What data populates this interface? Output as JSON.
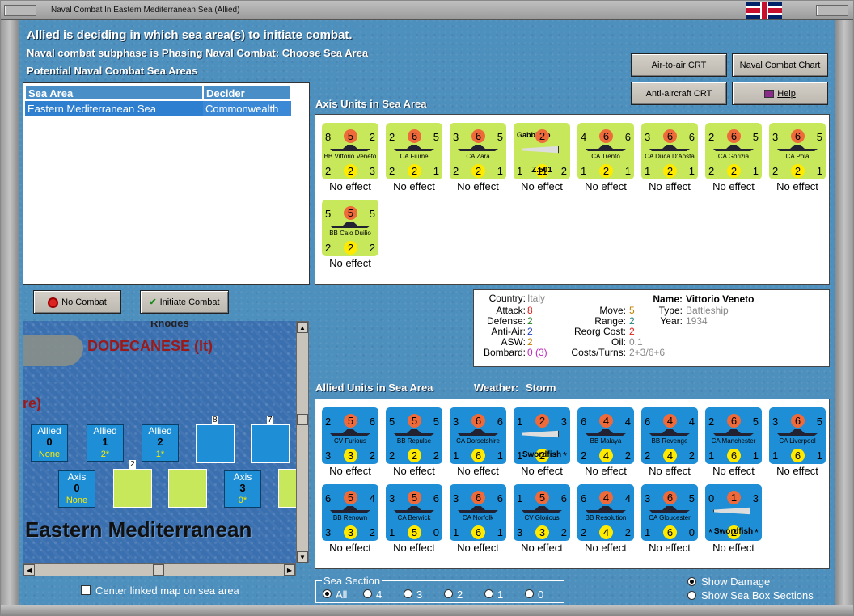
{
  "window": {
    "title": "Naval Combat In Eastern Mediterranean Sea (Allied)"
  },
  "header": {
    "status": "Allied is deciding in which sea area(s) to initiate combat.",
    "subphase": "Naval combat subphase is Phasing Naval Combat: Choose Sea Area",
    "potential": "Potential Naval Combat Sea Areas"
  },
  "buttons": {
    "air_to_air": "Air-to-air CRT",
    "naval_chart": "Naval Combat Chart",
    "anti_aircraft": "Anti-aircraft CRT",
    "help": "Help",
    "no_combat": "No Combat",
    "initiate_combat": "Initiate Combat"
  },
  "sea_table": {
    "columns": [
      "Sea Area",
      "Decider"
    ],
    "rows": [
      [
        "Eastern Mediterranean Sea",
        "Commonwealth"
      ]
    ]
  },
  "axis_title": "Axis Units in Sea Area",
  "allied_title": "Allied Units in Sea Area",
  "weather_label": "Weather:",
  "weather": "Storm",
  "effect_text": "No effect",
  "axis_units": [
    {
      "name": "BB Vittorio Veneto",
      "tl": "8",
      "tc": "5",
      "tr": "2",
      "bl": "2",
      "bc": "2",
      "br": "3"
    },
    {
      "name": "CA Fiume",
      "tl": "2",
      "tc": "6",
      "tr": "5",
      "bl": "2",
      "bc": "2",
      "br": "1"
    },
    {
      "name": "CA Zara",
      "tl": "3",
      "tc": "6",
      "tr": "5",
      "bl": "2",
      "bc": "2",
      "br": "1"
    },
    {
      "name": "Z.501",
      "tl": "Gabbiano",
      "tc": "2",
      "tr": "",
      "bl": "1",
      "bc": "11",
      "br": "2",
      "air": true
    },
    {
      "name": "CA Trento",
      "tl": "4",
      "tc": "6",
      "tr": "6",
      "bl": "1",
      "bc": "2",
      "br": "1"
    },
    {
      "name": "CA Duca D'Aosta",
      "tl": "3",
      "tc": "6",
      "tr": "6",
      "bl": "1",
      "bc": "2",
      "br": "1"
    },
    {
      "name": "CA Gorizia",
      "tl": "2",
      "tc": "6",
      "tr": "5",
      "bl": "2",
      "bc": "2",
      "br": "1"
    },
    {
      "name": "CA Pola",
      "tl": "3",
      "tc": "6",
      "tr": "5",
      "bl": "2",
      "bc": "2",
      "br": "1"
    },
    {
      "name": "BB Caio Duilio",
      "tl": "5",
      "tc": "5",
      "tr": "5",
      "bl": "2",
      "bc": "2",
      "br": "2"
    }
  ],
  "allied_units": [
    {
      "name": "CV Furious",
      "tl": "2",
      "tc": "5",
      "tr": "6",
      "bl": "3",
      "bc": "3",
      "br": "2"
    },
    {
      "name": "BB Repulse",
      "tl": "5",
      "tc": "5",
      "tr": "5",
      "bl": "2",
      "bc": "2",
      "br": "2"
    },
    {
      "name": "CA Dorsetshire",
      "tl": "3",
      "tc": "6",
      "tr": "6",
      "bl": "1",
      "bc": "6",
      "br": "1"
    },
    {
      "name": "Swordfish",
      "tl": "1",
      "tc": "2",
      "tr": "3",
      "bl": "1",
      "bc": "2",
      "br": "*",
      "air": true
    },
    {
      "name": "BB Malaya",
      "tl": "6",
      "tc": "4",
      "tr": "4",
      "bl": "2",
      "bc": "4",
      "br": "2"
    },
    {
      "name": "BB Revenge",
      "tl": "6",
      "tc": "4",
      "tr": "4",
      "bl": "2",
      "bc": "4",
      "br": "2"
    },
    {
      "name": "CA Manchester",
      "tl": "2",
      "tc": "6",
      "tr": "5",
      "bl": "1",
      "bc": "6",
      "br": "1"
    },
    {
      "name": "CA Liverpool",
      "tl": "3",
      "tc": "6",
      "tr": "5",
      "bl": "1",
      "bc": "6",
      "br": "1"
    },
    {
      "name": "BB Renown",
      "tl": "6",
      "tc": "5",
      "tr": "4",
      "bl": "3",
      "bc": "3",
      "br": "2"
    },
    {
      "name": "CA Berwick",
      "tl": "3",
      "tc": "5",
      "tr": "6",
      "bl": "1",
      "bc": "5",
      "br": "0"
    },
    {
      "name": "CA Norfolk",
      "tl": "3",
      "tc": "6",
      "tr": "6",
      "bl": "1",
      "bc": "6",
      "br": "1"
    },
    {
      "name": "CV Glorious",
      "tl": "1",
      "tc": "5",
      "tr": "6",
      "bl": "3",
      "bc": "3",
      "br": "2"
    },
    {
      "name": "BB Resolution",
      "tl": "6",
      "tc": "4",
      "tr": "4",
      "bl": "2",
      "bc": "4",
      "br": "2"
    },
    {
      "name": "CA Gloucester",
      "tl": "3",
      "tc": "6",
      "tr": "5",
      "bl": "1",
      "bc": "6",
      "br": "0"
    },
    {
      "name": "Swordfish",
      "tl": "0",
      "tc": "1",
      "tr": "3",
      "bl": "*",
      "bc": "2",
      "br": "*",
      "air": true
    }
  ],
  "info": {
    "country_l": "Country:",
    "country": "Italy",
    "attack_l": "Attack:",
    "attack": "8",
    "defense_l": "Defense:",
    "defense": "2",
    "antiair_l": "Anti-Air:",
    "antiair": "2",
    "asw_l": "ASW:",
    "asw": "2",
    "bombard_l": "Bombard:",
    "bombard": "0 (3)",
    "move_l": "Move:",
    "move": "5",
    "range_l": "Range:",
    "range": "2",
    "reorg_l": "Reorg Cost:",
    "reorg": "2",
    "oil_l": "Oil:",
    "oil": "0.1",
    "costs_l": "Costs/Turns:",
    "costs": "2+3/6+6",
    "name_l": "Name:",
    "name": "Vittorio Veneto",
    "type_l": "Type:",
    "type": "Battleship",
    "year_l": "Year:",
    "year": "1934"
  },
  "map": {
    "region": "DODECANESE (It)",
    "island": "Rhodes",
    "sea": "Eastern Mediterranean",
    "frag": "re)",
    "allied_boxes": [
      {
        "label": "Allied",
        "num": "0",
        "sub": "None"
      },
      {
        "label": "Allied",
        "num": "1",
        "sub": "2*"
      },
      {
        "label": "Allied",
        "num": "2",
        "sub": "1*"
      }
    ],
    "axis_boxes": [
      {
        "label": "Axis",
        "num": "0",
        "sub": "None"
      },
      {
        "label": "Axis",
        "num": "3",
        "sub": "0*"
      }
    ],
    "stack_counts": [
      "8",
      "7",
      "2"
    ]
  },
  "center_map": "Center linked map on sea area",
  "sea_section": {
    "title": "Sea Section",
    "options": [
      "All",
      "4",
      "3",
      "2",
      "1",
      "0"
    ]
  },
  "show_damage": "Show Damage",
  "show_sections": "Show Sea Box Sections",
  "colors": {
    "axis_unit": "#c7e85a",
    "allied_unit": "#1e8fd6",
    "attack": "#ee6a3a",
    "defense": "#ffea00"
  }
}
